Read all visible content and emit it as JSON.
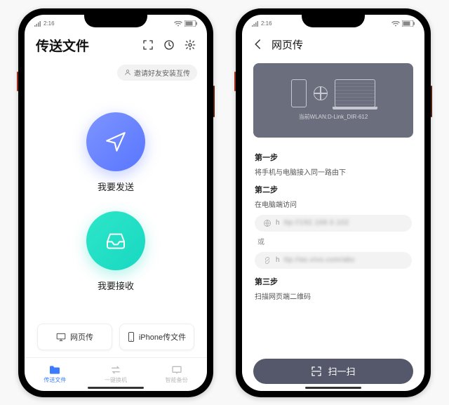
{
  "status": {
    "time": "2:16"
  },
  "screen1": {
    "title": "传送文件",
    "invite": "邀请好友安装互传",
    "send_label": "我要发送",
    "recv_label": "我要接收",
    "web_card": "网页传",
    "iphone_card": "iPhone传文件",
    "tab1": "传送文件",
    "tab2": "一键换机",
    "tab3": "智能备份"
  },
  "screen2": {
    "title": "网页传",
    "illus_caption": "当前WLAN:D-Link_DIR-612",
    "step1_title": "第一步",
    "step1_desc": "将手机与电脑接入同一路由下",
    "step2_title": "第二步",
    "step2_desc": "在电脑端访问",
    "addr1_prefix": "h",
    "addr1_blur": "ttp://192.168.0.102",
    "or": "或",
    "addr2_prefix": "h",
    "addr2_blur": "ttp://as.vivo.com/abc",
    "step3_title": "第三步",
    "step3_desc": "扫描网页端二维码",
    "scan_label": "扫一扫"
  }
}
